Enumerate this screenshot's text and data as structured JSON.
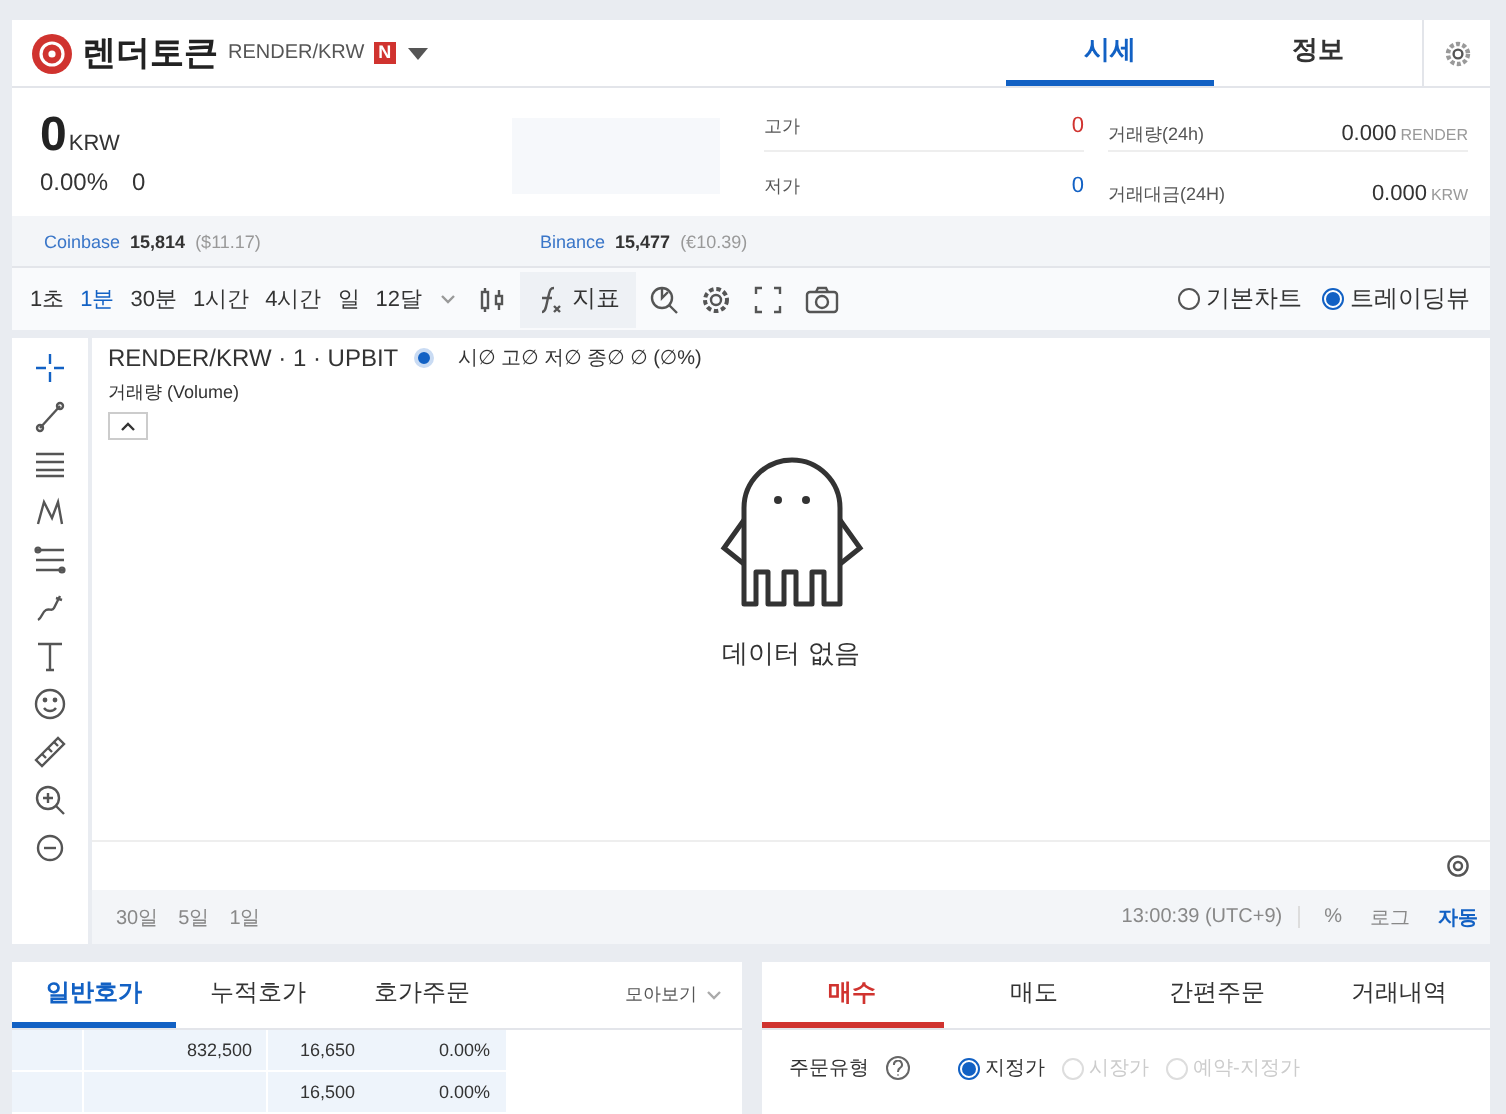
{
  "coin": {
    "name": "렌더토큰",
    "pair": "RENDER/KRW",
    "badge": "N"
  },
  "tabs": [
    {
      "label": "시세",
      "selected": true
    },
    {
      "label": "정보",
      "selected": false
    }
  ],
  "price": {
    "value": "0",
    "unit": "KRW",
    "change_rate": "0.00%",
    "change": "0"
  },
  "stats": [
    {
      "label": "고가",
      "value": "0",
      "kind": "rise"
    },
    {
      "label": "저가",
      "value": "0",
      "kind": "fall"
    }
  ],
  "volume_stats": [
    {
      "label": "거래량(24h)",
      "value": "0.000",
      "unit": "RENDER"
    },
    {
      "label": "거래대금(24H)",
      "value": "0.000",
      "unit": "KRW"
    }
  ],
  "exchanges": [
    {
      "name": "Coinbase",
      "price": "15,814",
      "converted": "($11.17)"
    },
    {
      "name": "Binance",
      "price": "15,477",
      "converted": "(€10.39)"
    }
  ],
  "intervals": [
    {
      "label": "1초",
      "selected": false
    },
    {
      "label": "1분",
      "selected": true
    },
    {
      "label": "30분",
      "selected": false
    },
    {
      "label": "1시간",
      "selected": false
    },
    {
      "label": "4시간",
      "selected": false
    },
    {
      "label": "일",
      "selected": false
    },
    {
      "label": "12달",
      "selected": false
    }
  ],
  "indicator_label": "지표",
  "chart_modes": [
    {
      "label": "기본차트",
      "selected": false
    },
    {
      "label": "트레이딩뷰",
      "selected": true
    }
  ],
  "chart": {
    "symbol": "RENDER/KRW · 1 · UPBIT",
    "ohlc": "시∅ 고∅ 저∅ 종∅ ∅ (∅%)",
    "volume_label": "거래량 (Volume)",
    "empty_message": "데이터 없음",
    "ranges": [
      "30일",
      "5일",
      "1일"
    ],
    "time": "13:00:39 (UTC+9)",
    "scales": [
      {
        "label": "%",
        "selected": false
      },
      {
        "label": "로그",
        "selected": false
      },
      {
        "label": "자동",
        "selected": true
      }
    ]
  },
  "orderbook": {
    "tabs": [
      {
        "label": "일반호가",
        "selected": true
      },
      {
        "label": "누적호가",
        "selected": false
      },
      {
        "label": "호가주문",
        "selected": false
      }
    ],
    "group_label": "모아보기",
    "rows": [
      {
        "volume": "832,500",
        "price": "16,650",
        "rate": "0.00%"
      },
      {
        "price": "16,500",
        "rate": "0.00%"
      }
    ]
  },
  "order": {
    "tabs": [
      {
        "label": "매수",
        "selected": true
      },
      {
        "label": "매도",
        "selected": false
      },
      {
        "label": "간편주문",
        "selected": false
      },
      {
        "label": "거래내역",
        "selected": false
      }
    ],
    "type_label": "주문유형",
    "types": [
      {
        "label": "지정가",
        "selected": true,
        "disabled": false
      },
      {
        "label": "시장가",
        "selected": false,
        "disabled": true
      },
      {
        "label": "예약-지정가",
        "selected": false,
        "disabled": true
      }
    ]
  }
}
